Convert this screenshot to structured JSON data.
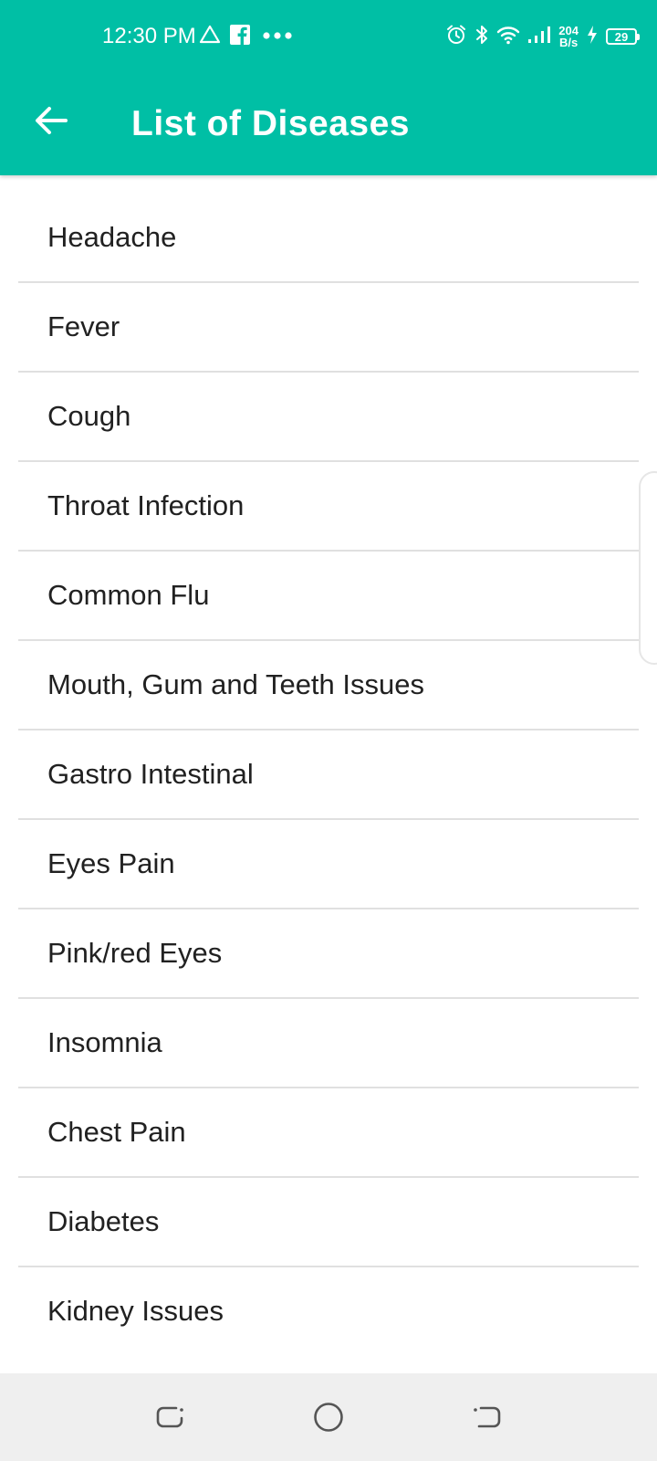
{
  "status_bar": {
    "time": "12:30 PM",
    "net_speed_value": "204",
    "net_speed_unit": "B/s",
    "battery_level": "29",
    "icons": [
      "drive-icon",
      "facebook-icon",
      "more-dots-icon",
      "alarm-icon",
      "bluetooth-icon",
      "wifi-icon",
      "signal-icon",
      "charging-icon",
      "battery-icon"
    ]
  },
  "toolbar": {
    "title": "List of Diseases",
    "back_icon": "arrow-back-icon"
  },
  "diseases": [
    "Headache",
    "Fever",
    "Cough",
    "Throat Infection",
    "Common Flu",
    "Mouth, Gum and Teeth Issues",
    "Gastro Intestinal",
    "Eyes Pain",
    "Pink/red Eyes",
    "Insomnia",
    "Chest Pain",
    "Diabetes",
    "Kidney Issues"
  ],
  "nav_bar": {
    "icons": [
      "recents-icon",
      "home-icon",
      "back-icon"
    ]
  },
  "colors": {
    "primary": "#00bfa5",
    "divider": "#e0e0e0",
    "text": "#212121",
    "nav_bar": "#efefef"
  }
}
